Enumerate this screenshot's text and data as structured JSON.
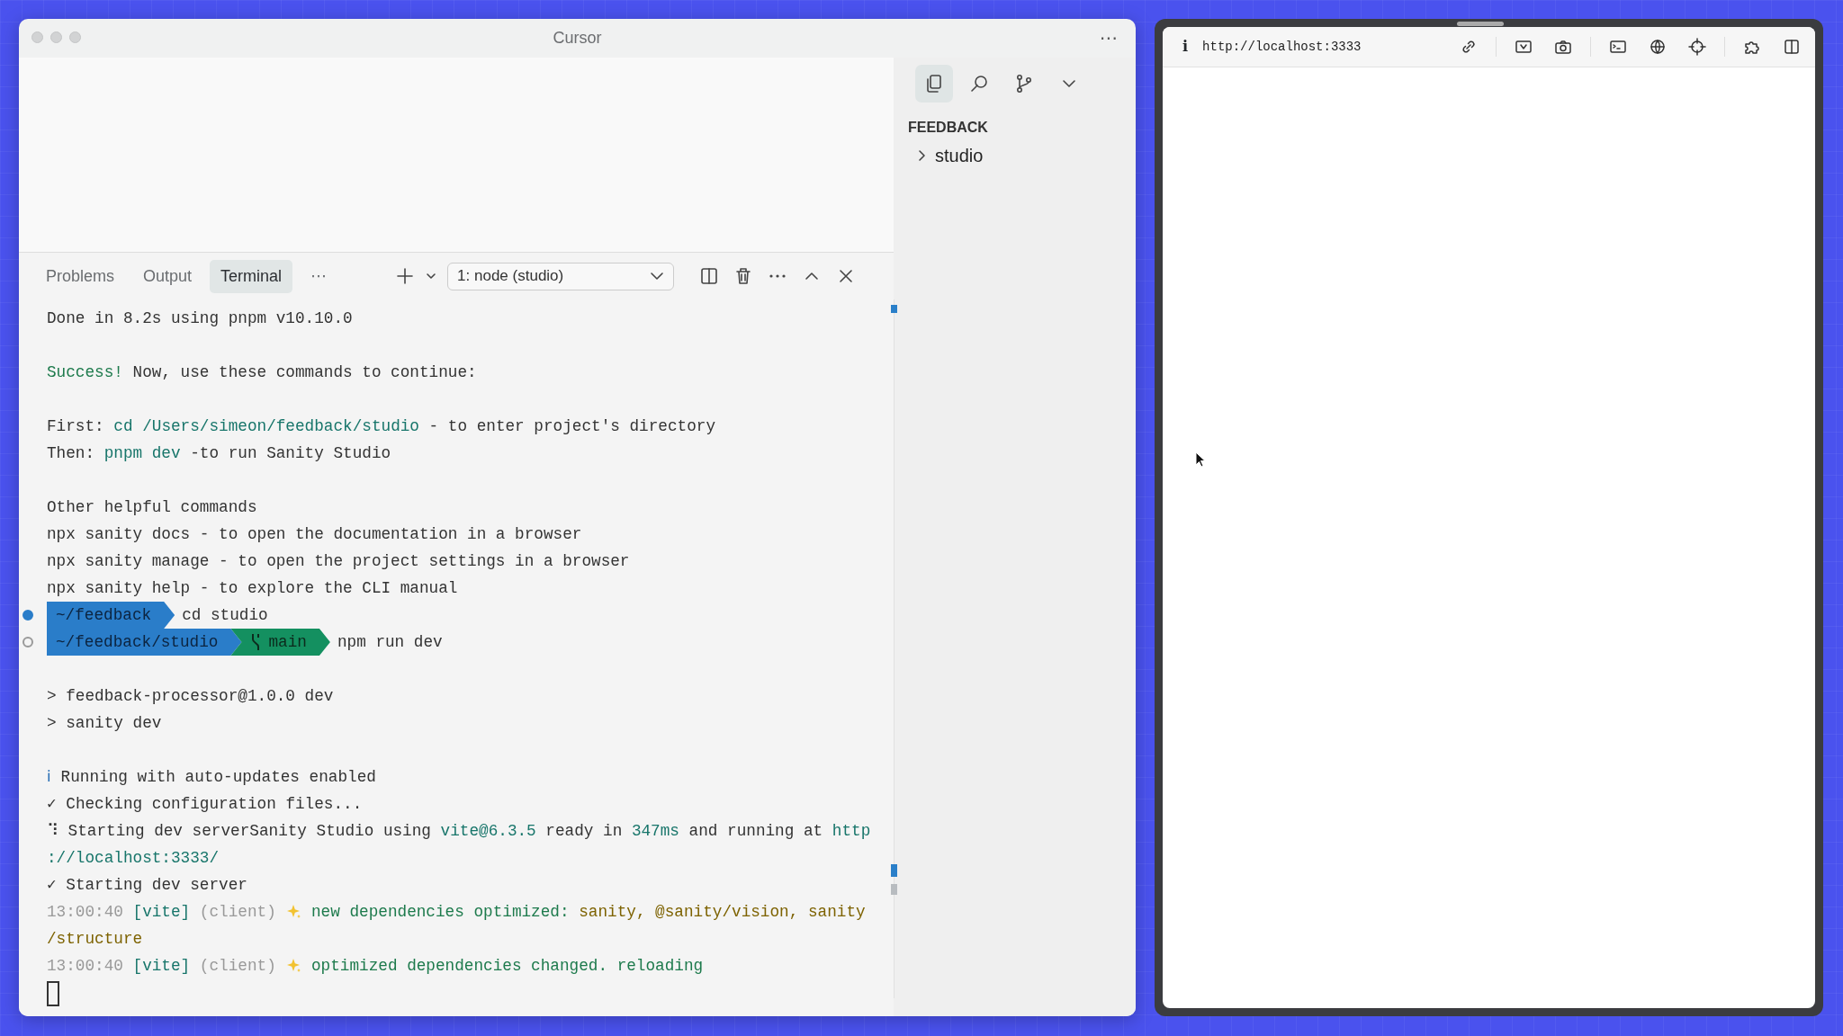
{
  "window": {
    "title": "Cursor",
    "menu": "⋯"
  },
  "activity_tabs": [
    {
      "selected": true
    },
    {
      "selected": false
    },
    {
      "selected": false
    }
  ],
  "explorer": {
    "section": "FEEDBACK",
    "items": [
      {
        "label": "studio",
        "expanded": false
      }
    ]
  },
  "panel": {
    "tabs": [
      {
        "label": "Problems",
        "selected": false
      },
      {
        "label": "Output",
        "selected": false
      },
      {
        "label": "Terminal",
        "selected": true
      }
    ],
    "overflow": "⋯",
    "terminal_select": "1: node (studio)"
  },
  "terminal": {
    "lines": [
      {
        "kind": "text",
        "segments": [
          {
            "kind": "plain",
            "text": "Done in 8.2s using pnpm v10.10.0"
          }
        ]
      },
      {
        "kind": "blank"
      },
      {
        "kind": "text",
        "segments": [
          {
            "kind": "green",
            "text": "Success!"
          },
          {
            "kind": "plain",
            "text": " Now, use these commands to continue:"
          }
        ]
      },
      {
        "kind": "blank"
      },
      {
        "kind": "text",
        "segments": [
          {
            "kind": "plain",
            "text": "First: "
          },
          {
            "kind": "teal",
            "text": "cd /Users/simeon/feedback/studio"
          },
          {
            "kind": "plain",
            "text": " - to enter project's directory"
          }
        ]
      },
      {
        "kind": "text",
        "segments": [
          {
            "kind": "plain",
            "text": "Then: "
          },
          {
            "kind": "teal",
            "text": "pnpm dev"
          },
          {
            "kind": "plain",
            "text": " -to run Sanity Studio"
          }
        ]
      },
      {
        "kind": "blank"
      },
      {
        "kind": "text",
        "segments": [
          {
            "kind": "plain",
            "text": "Other helpful commands"
          }
        ]
      },
      {
        "kind": "text",
        "segments": [
          {
            "kind": "plain",
            "text": "npx sanity docs - to open the documentation in a browser"
          }
        ]
      },
      {
        "kind": "text",
        "segments": [
          {
            "kind": "plain",
            "text": "npx sanity manage - to open the project settings in a browser"
          }
        ]
      },
      {
        "kind": "text",
        "segments": [
          {
            "kind": "plain",
            "text": "npx sanity help - to explore the CLI manual"
          }
        ]
      },
      {
        "kind": "prompt",
        "active": true,
        "path": "~/feedback",
        "command": "cd studio"
      },
      {
        "kind": "prompt",
        "active": false,
        "path": "~/feedback/studio",
        "branch": "main",
        "command": "npm run dev"
      },
      {
        "kind": "blank"
      },
      {
        "kind": "text",
        "segments": [
          {
            "kind": "plain",
            "text": "> feedback-processor@1.0.0 dev"
          }
        ]
      },
      {
        "kind": "text",
        "segments": [
          {
            "kind": "plain",
            "text": "> sanity dev"
          }
        ]
      },
      {
        "kind": "blank"
      },
      {
        "kind": "text",
        "segments": [
          {
            "kind": "info",
            "text": "ℹ"
          },
          {
            "kind": "plain",
            "text": " Running with auto-updates enabled"
          }
        ]
      },
      {
        "kind": "text",
        "segments": [
          {
            "kind": "plain",
            "text": "✓ Checking configuration files..."
          }
        ]
      },
      {
        "kind": "text",
        "segments": [
          {
            "kind": "plain",
            "text": "⠹ Starting dev serverSanity Studio using "
          },
          {
            "kind": "teal",
            "text": "vite@6.3.5"
          },
          {
            "kind": "plain",
            "text": " ready in "
          },
          {
            "kind": "teal",
            "text": "347ms"
          },
          {
            "kind": "plain",
            "text": " and running at "
          },
          {
            "kind": "teal",
            "text": "http"
          }
        ]
      },
      {
        "kind": "text",
        "segments": [
          {
            "kind": "teal",
            "text": "://localhost:3333/"
          }
        ]
      },
      {
        "kind": "text",
        "segments": [
          {
            "kind": "plain",
            "text": "✓ Starting dev server"
          }
        ]
      },
      {
        "kind": "text",
        "segments": [
          {
            "kind": "dim",
            "text": "13:00:40 "
          },
          {
            "kind": "teal",
            "text": "[vite]"
          },
          {
            "kind": "dim",
            "text": " (client) "
          },
          {
            "kind": "sparkle"
          },
          {
            "kind": "green",
            "text": " new dependencies optimized: "
          },
          {
            "kind": "yellow",
            "text": "sanity, @sanity/vision, sanity"
          }
        ]
      },
      {
        "kind": "text",
        "segments": [
          {
            "kind": "yellow",
            "text": "/structure"
          }
        ]
      },
      {
        "kind": "text",
        "segments": [
          {
            "kind": "dim",
            "text": "13:00:40 "
          },
          {
            "kind": "teal",
            "text": "[vite]"
          },
          {
            "kind": "dim",
            "text": " (client) "
          },
          {
            "kind": "sparkle"
          },
          {
            "kind": "green",
            "text": " optimized dependencies changed. reloading"
          }
        ]
      }
    ]
  },
  "browser": {
    "info": "i",
    "url": "http://localhost:3333"
  }
}
